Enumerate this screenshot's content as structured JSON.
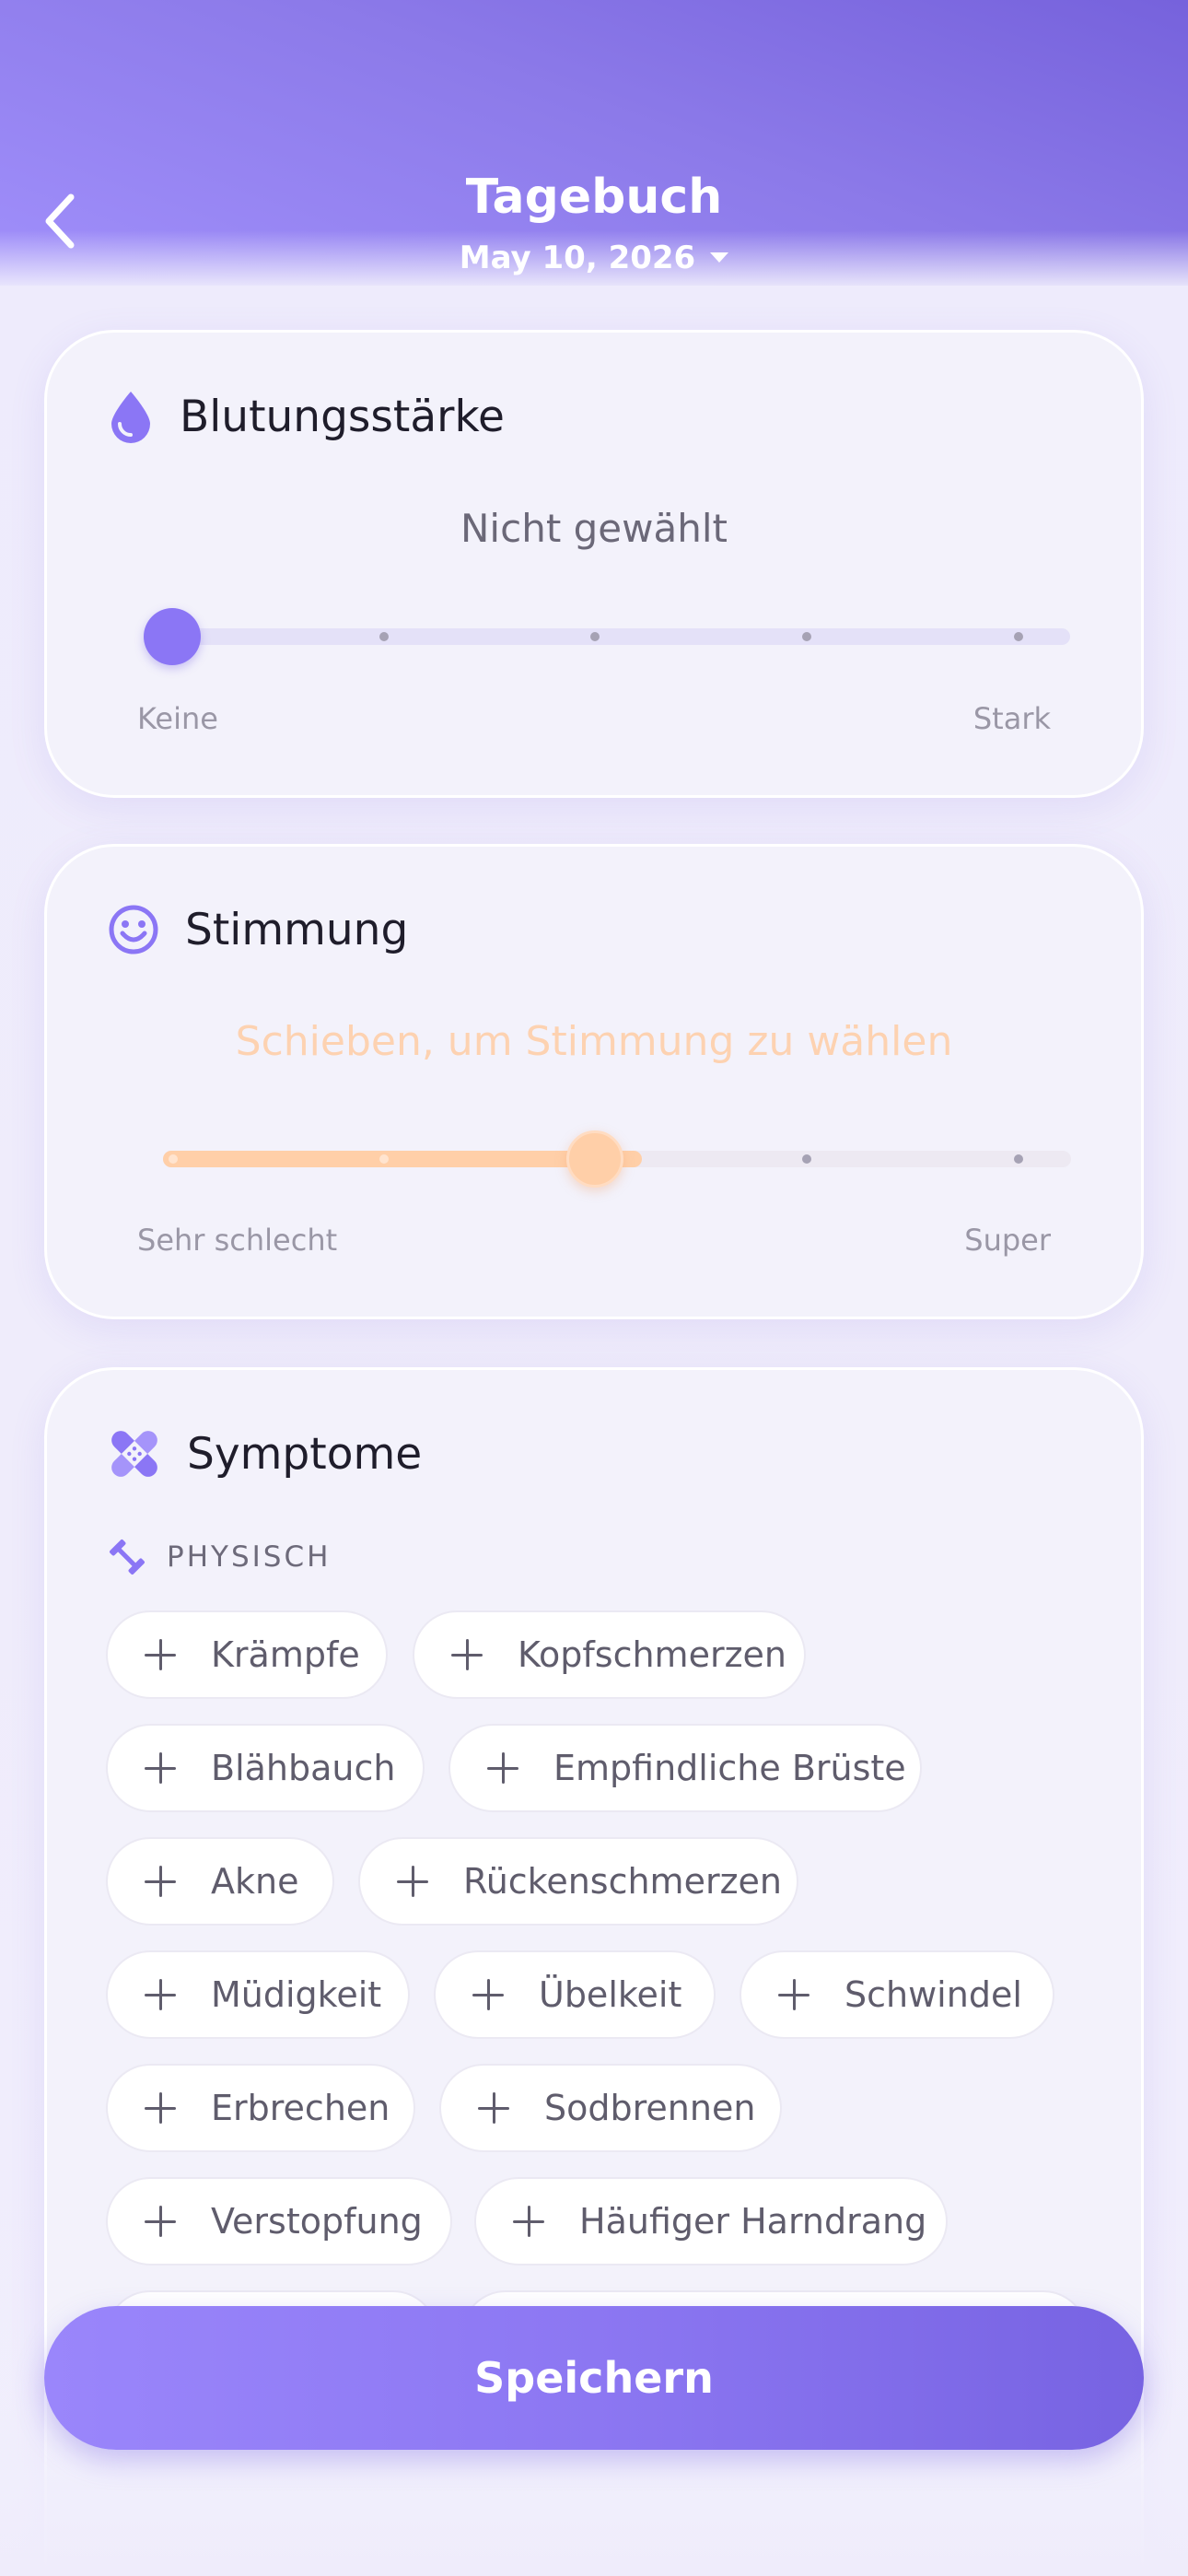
{
  "header": {
    "title": "Tagebuch",
    "date": "May 10, 2026"
  },
  "flow": {
    "title": "Blutungsstärke",
    "status": "Nicht gewählt",
    "min_label": "Keine",
    "max_label": "Stark",
    "value_fraction": 0.0,
    "accent_color": "#8b76f5"
  },
  "mood": {
    "title": "Stimmung",
    "status": "Schieben, um Stimmung zu wählen",
    "min_label": "Sehr schlecht",
    "max_label": "Super",
    "value_fraction": 0.5,
    "accent_color": "#ffcfa8"
  },
  "symptoms": {
    "title": "Symptome",
    "section": "PHYSISCH",
    "chips": [
      "Krämpfe",
      "Kopfschmerzen",
      "Blähbauch",
      "Empfindliche Brüste",
      "Akne",
      "Rückenschmerzen",
      "Müdigkeit",
      "Übelkeit",
      "Schwindel",
      "Erbrechen",
      "Sodbrennen",
      "Verstopfung",
      "Häufiger Harndrang"
    ]
  },
  "save_label": "Speichern"
}
